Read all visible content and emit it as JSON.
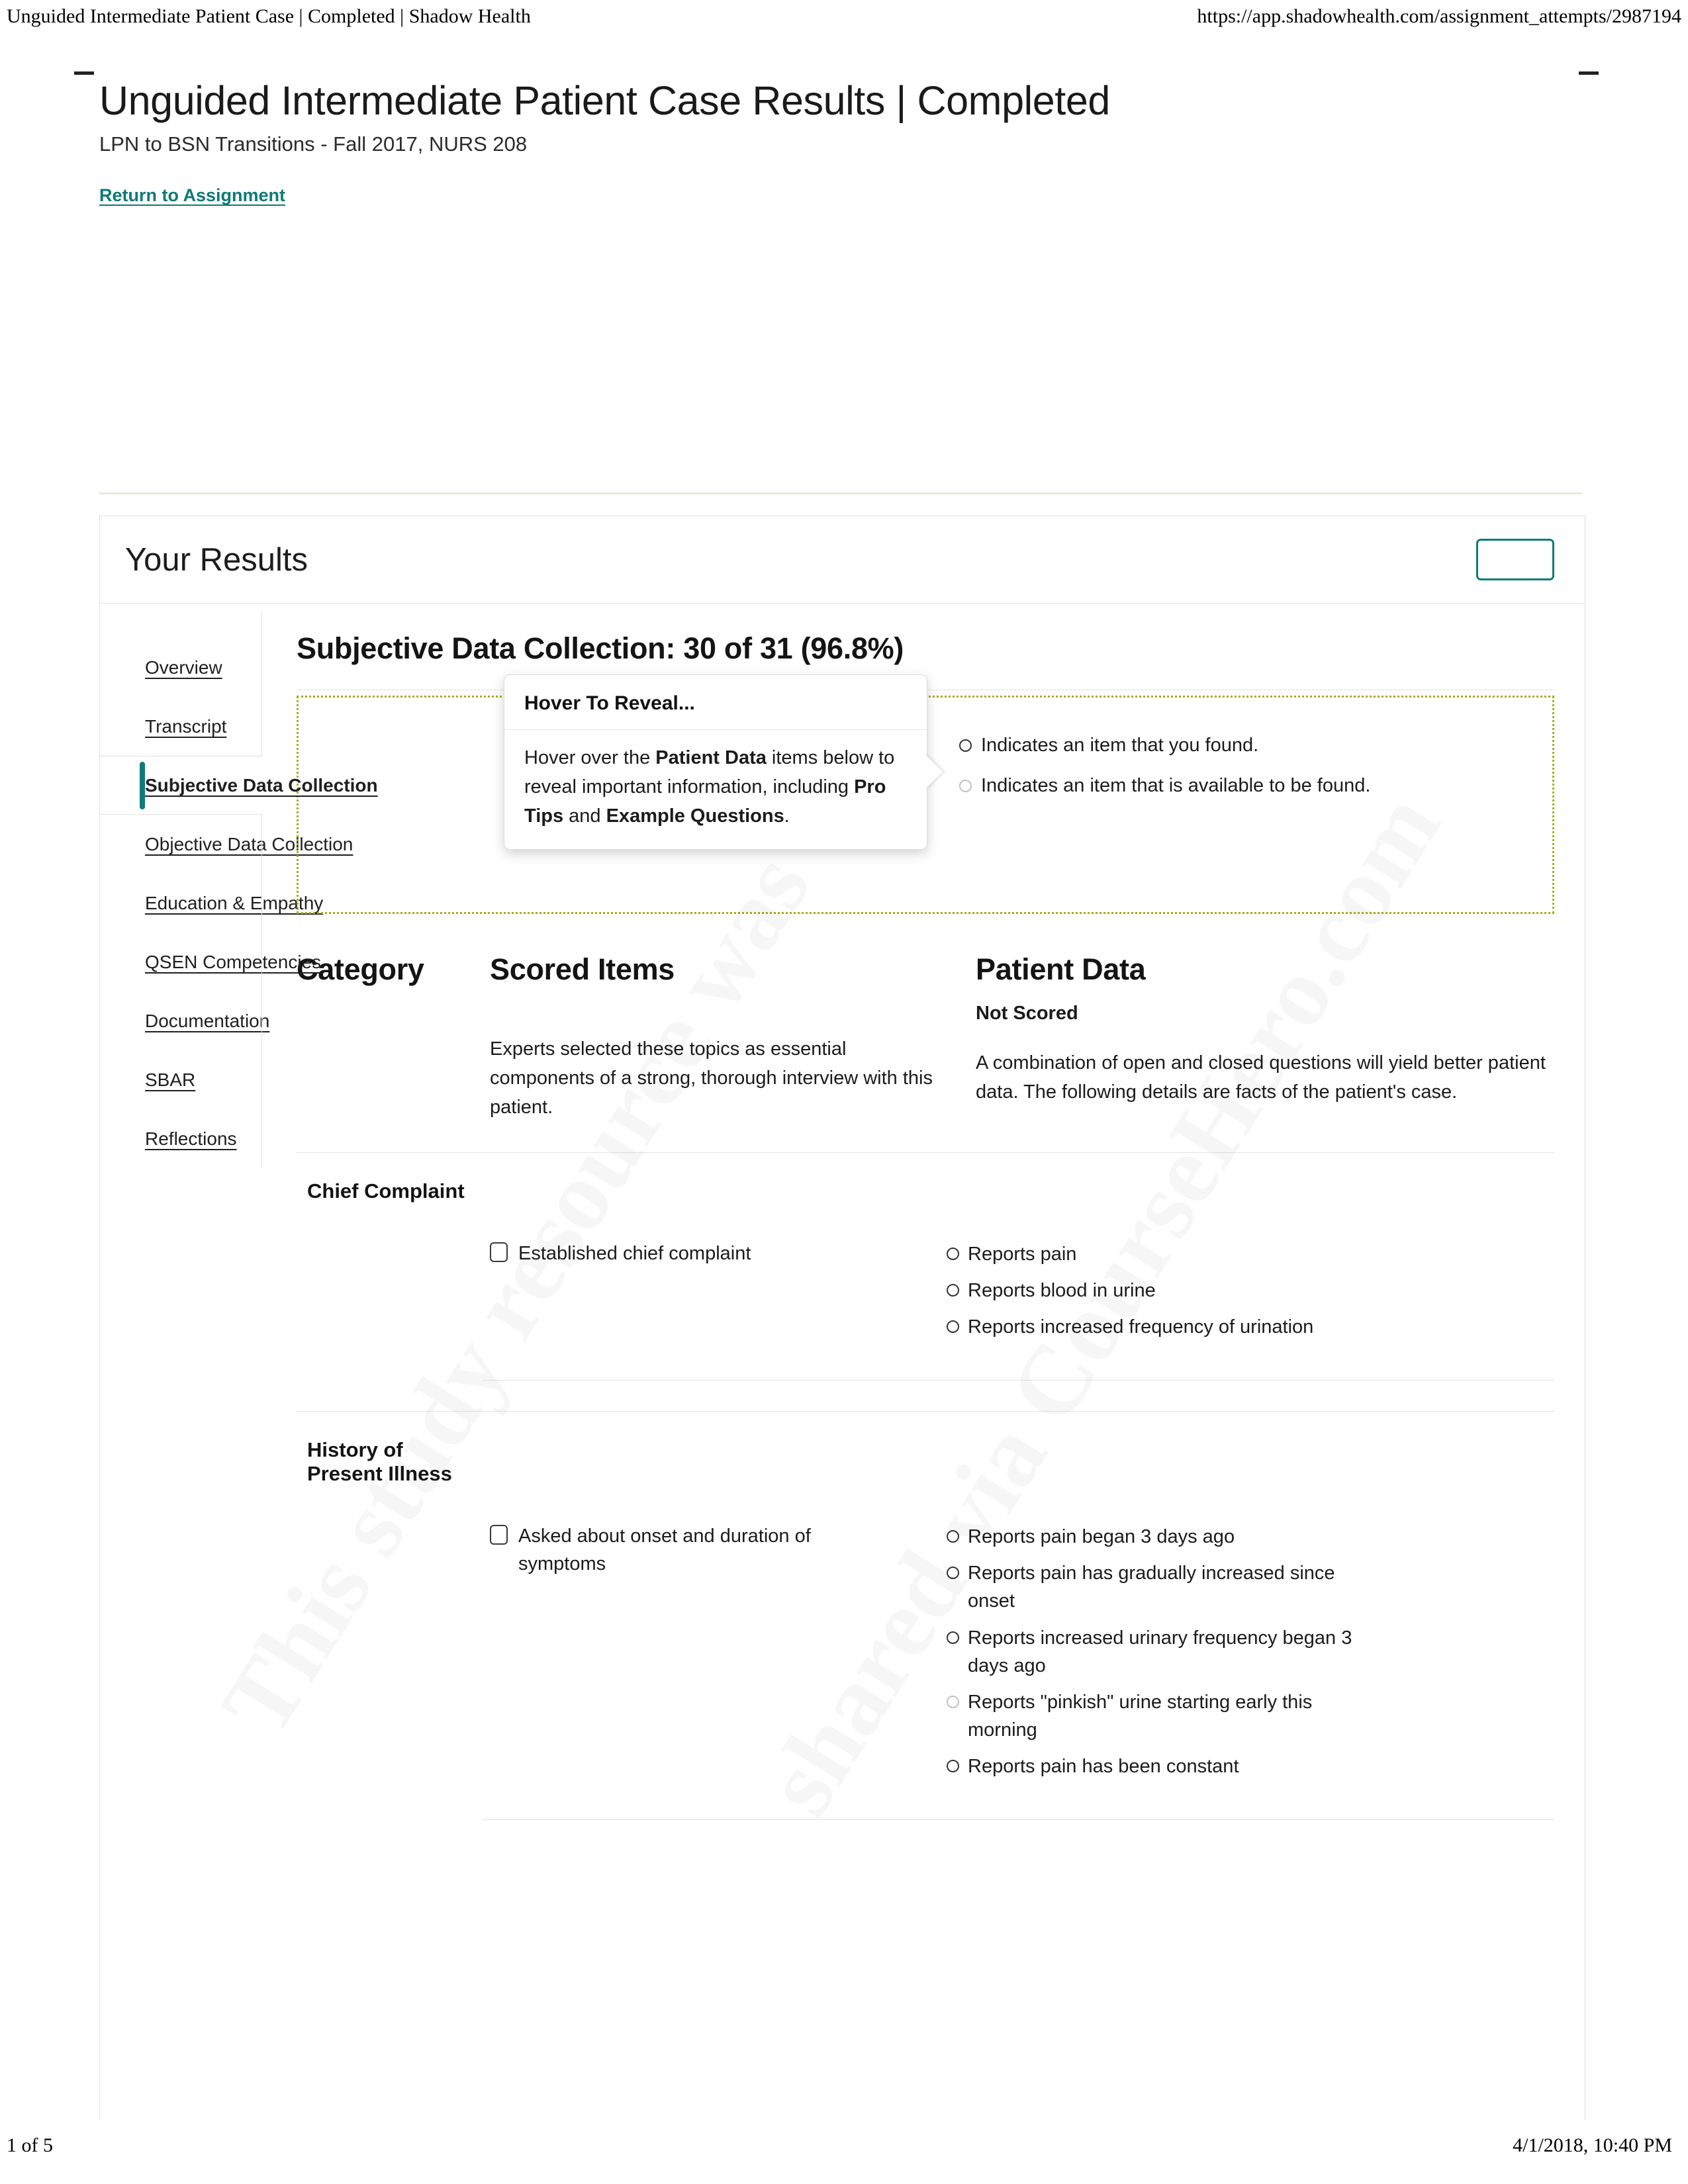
{
  "print": {
    "header_left": "Unguided Intermediate Patient Case | Completed | Shadow Health",
    "header_right": "https://app.shadowhealth.com/assignment_attempts/2987194",
    "footer_left": "1 of 5",
    "footer_right": "4/1/2018, 10:40 PM"
  },
  "watermark": {
    "line1": "This study resource was",
    "line2": "shared via CourseHero.com"
  },
  "page": {
    "title": "Unguided Intermediate Patient Case Results | Completed",
    "subtitle": "LPN to BSN Transitions - Fall 2017, NURS 208",
    "return_link": "Return to Assignment"
  },
  "panel": {
    "heading": "Your Results",
    "action_button_label": ""
  },
  "sidebar": {
    "items": [
      {
        "label": "Overview",
        "active": false
      },
      {
        "label": "Transcript",
        "active": false
      },
      {
        "label": "Subjective Data Collection",
        "active": true
      },
      {
        "label": "Objective Data Collection",
        "active": false
      },
      {
        "label": "Education & Empathy",
        "active": false
      },
      {
        "label": "QSEN Competencies",
        "active": false
      },
      {
        "label": "Documentation",
        "active": false
      },
      {
        "label": "SBAR",
        "active": false
      },
      {
        "label": "Reflections",
        "active": false
      }
    ]
  },
  "main": {
    "section_title": "Subjective Data Collection: 30 of 31 (96.8%)",
    "score": {
      "earned": 30,
      "total": 31,
      "percent": "96.8%"
    },
    "tooltip": {
      "title": "Hover To Reveal...",
      "body_prefix": "Hover over the ",
      "body_bold1": "Patient Data",
      "body_mid": " items below to reveal important information, including ",
      "body_bold2": "Pro Tips",
      "body_mid2": " and ",
      "body_bold3": "Example Questions",
      "body_suffix": "."
    },
    "legend": [
      {
        "text": "Indicates an item that you found.",
        "state": "found"
      },
      {
        "text": "Indicates an item that is available to be found.",
        "state": "available"
      }
    ],
    "columns": {
      "category": "Category",
      "scored_items": "Scored Items",
      "patient_data": "Patient Data",
      "patient_data_sub": "Not Scored"
    },
    "blurbs": {
      "scored_items": "Experts selected these topics as essential components of a strong, thorough interview with this patient.",
      "patient_data": "A combination of open and closed questions will yield better patient data. The following details are facts of the patient's case."
    },
    "categories": [
      {
        "name": "Chief Complaint",
        "scored_item": "Established chief complaint",
        "checked": false,
        "patient_data": [
          {
            "text": "Reports pain",
            "state": "found"
          },
          {
            "text": "Reports blood in urine",
            "state": "found"
          },
          {
            "text": "Reports increased frequency of urination",
            "state": "found"
          }
        ]
      },
      {
        "name": "History of Present Illness",
        "scored_item": "Asked about onset and duration of symptoms",
        "checked": false,
        "patient_data": [
          {
            "text": "Reports pain began 3 days ago",
            "state": "found"
          },
          {
            "text": "Reports pain has gradually increased since onset",
            "state": "found"
          },
          {
            "text": "Reports increased urinary frequency began 3 days ago",
            "state": "found"
          },
          {
            "text": "Reports \"pinkish\" urine starting early this morning",
            "state": "available"
          },
          {
            "text": "Reports pain has been constant",
            "state": "found"
          }
        ]
      }
    ]
  },
  "colors": {
    "accent_teal": "#0e7b7a",
    "legend_dash": "#a9ad12",
    "rule": "#e4e4e4",
    "olive_rule": "#e9e9dc"
  }
}
